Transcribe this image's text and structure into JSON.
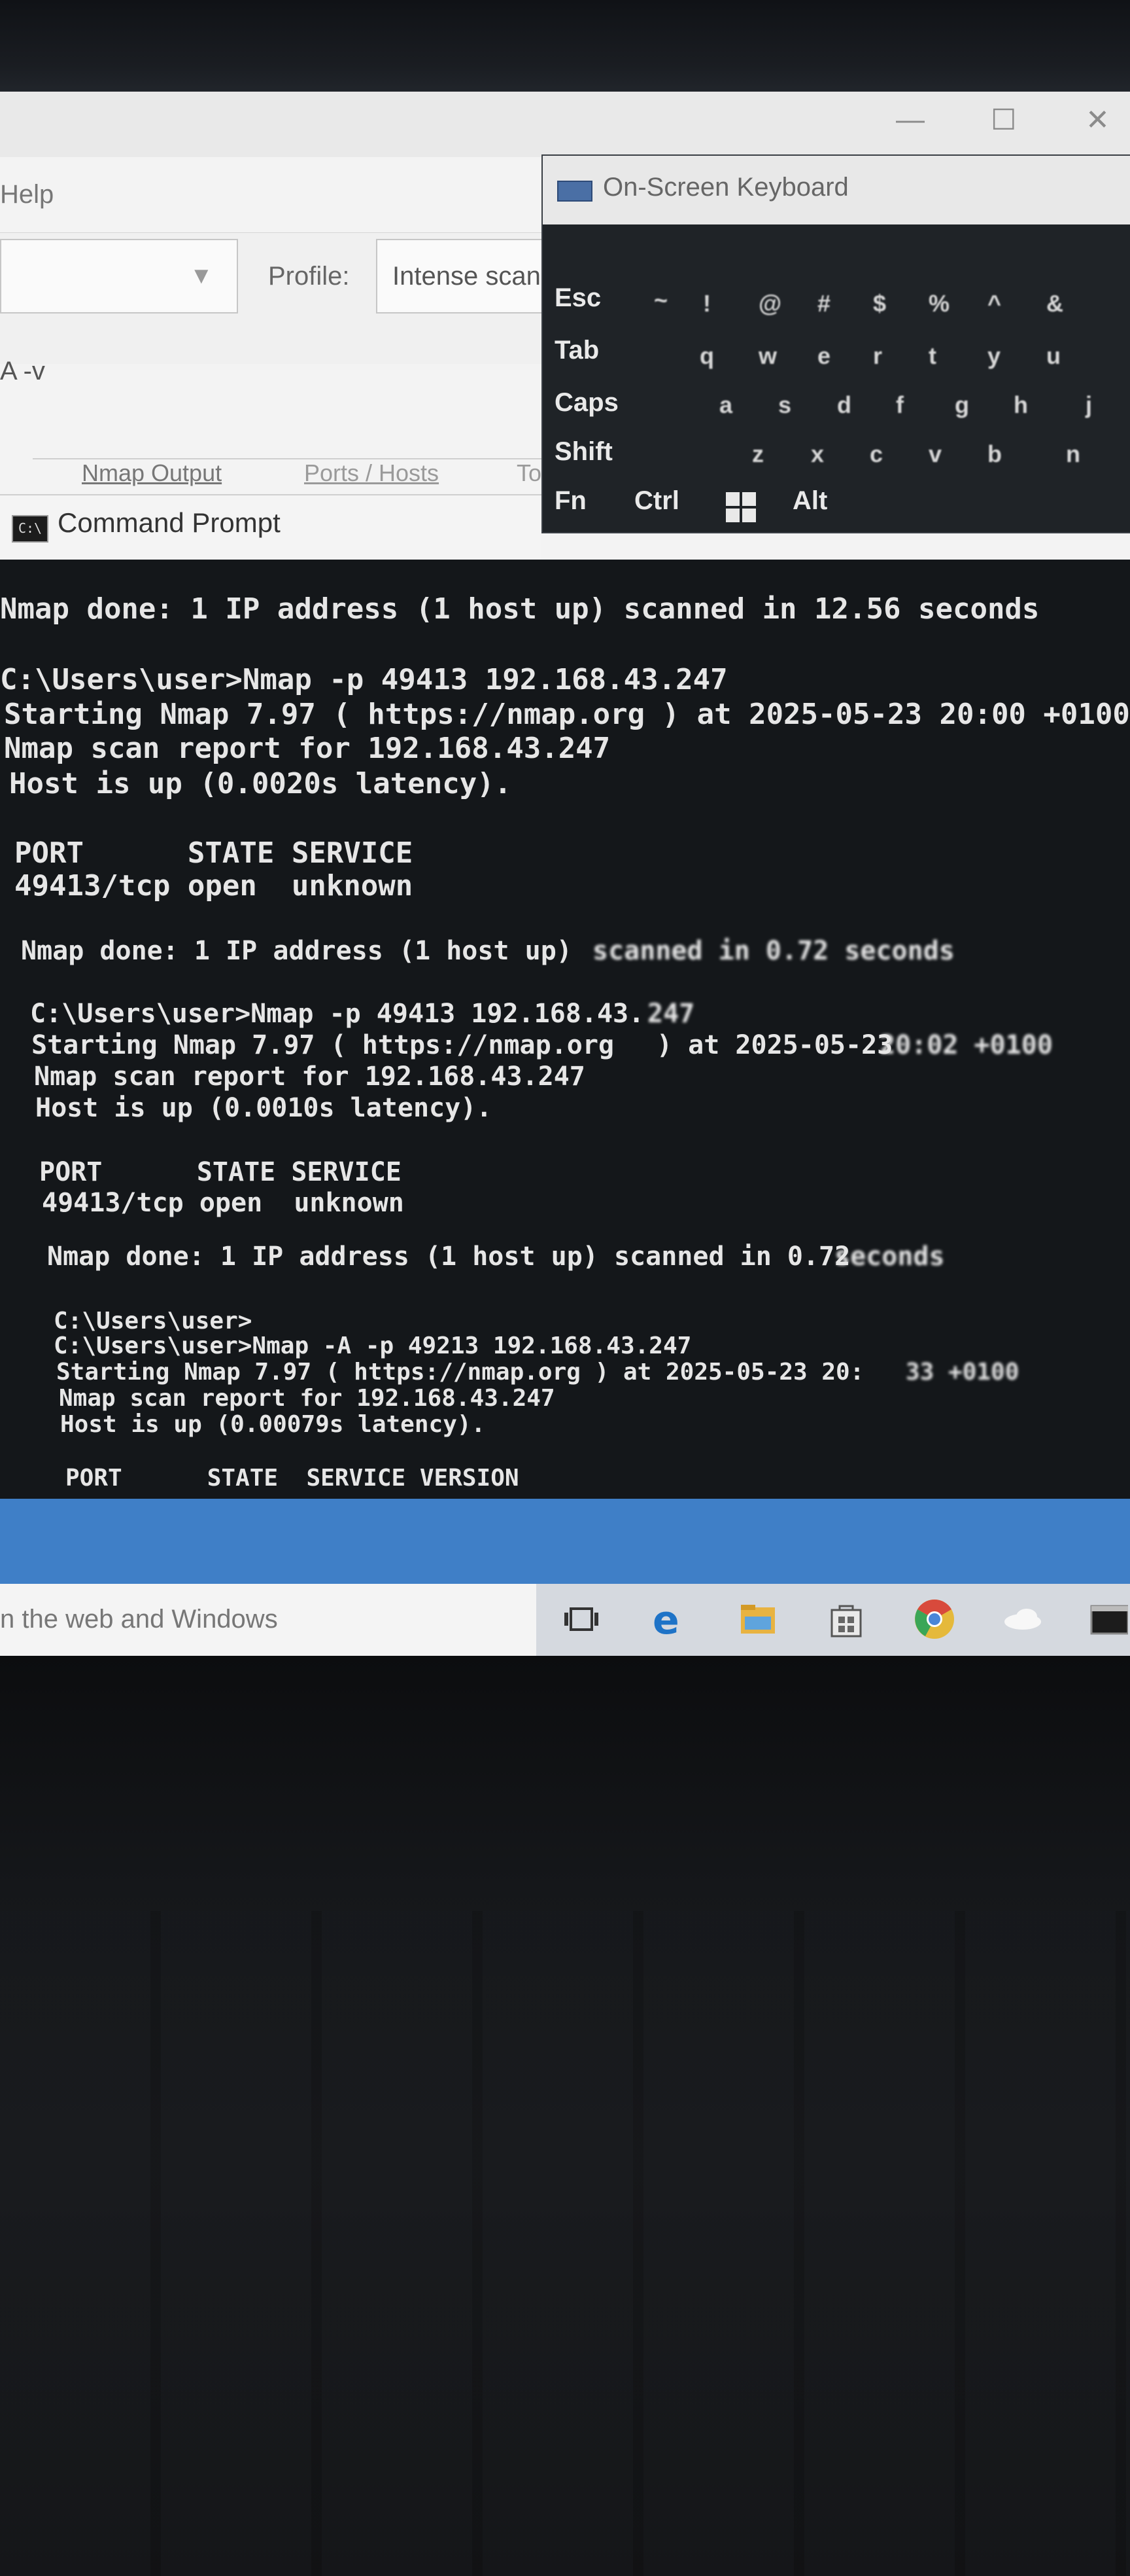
{
  "nmap_window": {
    "menu": "Help",
    "profile_label": "Profile:",
    "profile_value": "Intense scan",
    "command_fragment": "A -v",
    "tabs": [
      "Nmap Output",
      "Ports / Hosts",
      "To"
    ],
    "window_controls": [
      "minimize-icon",
      "maximize-icon",
      "close-icon"
    ]
  },
  "osk": {
    "title": "On-Screen Keyboard",
    "keys": [
      "Esc",
      "Tab",
      "Caps",
      "Shift",
      "Fn",
      "Ctrl",
      "Alt"
    ]
  },
  "cmd": {
    "title": "Command Prompt",
    "icon_text": "C:\\",
    "lines": [
      "Nmap done: 1 IP address (1 host up) scanned in 12.56 seconds",
      "C:\\Users\\user>Nmap -p 49413 192.168.43.247",
      "Starting Nmap 7.97 ( https://nmap.org ) at 2025-05-23 20:00 +0100",
      "Nmap scan report for 192.168.43.247",
      "Host is up (0.0020s latency).",
      "PORT      STATE SERVICE",
      "49413/tcp open  unknown",
      "Nmap done: 1 IP address (1 host up) ",
      "scanned in 0.72 seconds",
      "C:\\Users\\user>Nmap -p 49413 192.168.43.",
      "247",
      "Starting Nmap 7.97 ( https://nmap.org ",
      ") at 2025-05-23 ",
      "20:02 +0100",
      "Nmap scan report for 192.168.43.247",
      "Host is up (0.0010s latency).",
      "PORT      STATE SERVICE",
      "49413/tcp open  unknown",
      "Nmap done: 1 IP address (1 host up) scanned in 0.72 ",
      "seconds",
      "C:\\Users\\user>",
      "C:\\Users\\user>Nmap -A -p 49213 192.168.43.247",
      "Starting Nmap 7.97 ( https://nmap.org ) at 2025-05-23 20:",
      "33 +0100",
      "Nmap scan report for 192.168.43.247",
      "Host is up (0.00079s latency).",
      "PORT      STATE  SERVICE VERSION"
    ]
  },
  "taskbar": {
    "search_text": "n the web and Windows",
    "icons": [
      "task-view-icon",
      "edge-icon",
      "file-explorer-icon",
      "store-icon",
      "chrome-icon",
      "onedrive-icon",
      "cmd-taskbar-icon"
    ]
  },
  "colors": {
    "cmd_background": "#14171a",
    "cmd_text": "#e6e6e6",
    "taskbar_blue": "#3f7fc7",
    "osk_background": "#1f2327"
  }
}
